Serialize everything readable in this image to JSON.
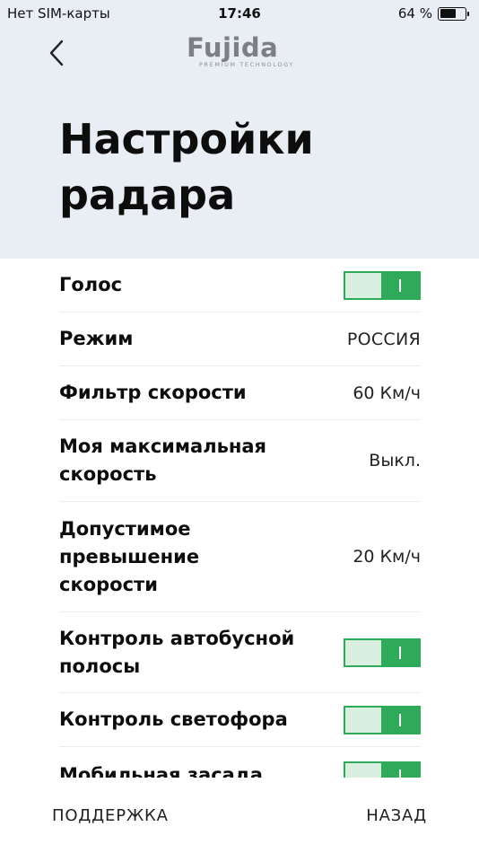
{
  "status_bar": {
    "carrier": "Нет SIM-карты",
    "time": "17:46",
    "battery_text": "64 %",
    "battery_level": 0.64
  },
  "header": {
    "logo_text": "Fujida",
    "logo_tagline": "PREMIUM TECHNOLOGY",
    "title": "Настройки радара"
  },
  "settings": {
    "voice": {
      "label": "Голос",
      "toggle_on": true
    },
    "mode": {
      "label": "Режим",
      "value": "РОССИЯ"
    },
    "speed_filter": {
      "label": "Фильтр скорости",
      "value": "60 Км/ч"
    },
    "max_speed": {
      "label": "Моя максимальная скорость",
      "value": "Выкл."
    },
    "allowed_excess": {
      "label": "Допустимое превышение скорости",
      "value": "20 Км/ч"
    },
    "bus_lane": {
      "label": "Контроль автобусной полосы",
      "toggle_on": true
    },
    "traffic_light": {
      "label": "Контроль светофора",
      "toggle_on": true
    },
    "mobile_ambush": {
      "label": "Мобильная засада",
      "toggle_on": true
    }
  },
  "footer": {
    "support_label": "ПОДДЕРЖКА",
    "back_label": "НАЗАД"
  },
  "colors": {
    "header_bg": "#e9eef5",
    "toggle_green": "#2eaa5a",
    "toggle_light": "#d9f0e0"
  },
  "icons": {
    "back": "chevron-left-icon",
    "battery": "battery-icon"
  }
}
